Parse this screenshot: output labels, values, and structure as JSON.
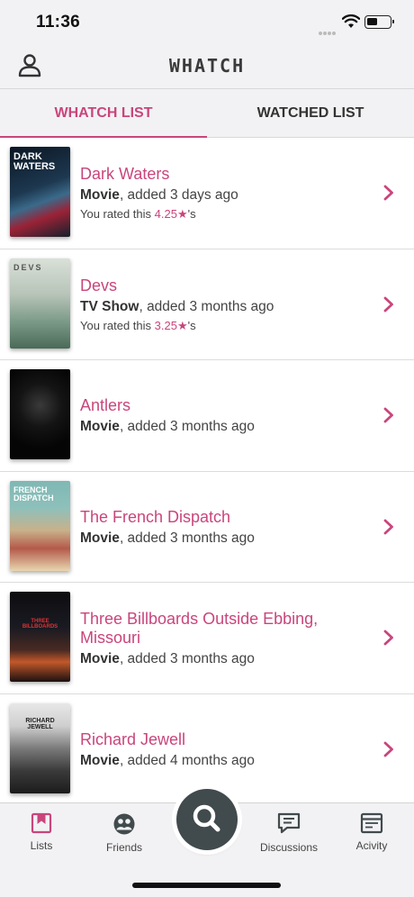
{
  "status_bar": {
    "time": "11:36"
  },
  "header": {
    "logo": "WHATCH",
    "profile_icon": "person-icon"
  },
  "tabs": [
    {
      "label": "WHATCH LIST",
      "active": true
    },
    {
      "label": "WATCHED LIST",
      "active": false
    }
  ],
  "accent_color": "#c9457c",
  "items": [
    {
      "title": "Dark Waters",
      "type": "Movie",
      "added": ", added 3 days ago",
      "rating_prefix": "You rated this ",
      "rating": "4.25★",
      "rating_suffix": "'s",
      "poster_text": "DARK WATERS"
    },
    {
      "title": "Devs",
      "type": "TV Show",
      "added": ", added 3 months ago",
      "rating_prefix": "You rated this ",
      "rating": "3.25★",
      "rating_suffix": "'s",
      "poster_text": "DEVS"
    },
    {
      "title": "Antlers",
      "type": "Movie",
      "added": ", added 3 months ago",
      "poster_text": ""
    },
    {
      "title": "The French Dispatch",
      "type": "Movie",
      "added": ", added 3 months ago",
      "poster_text": "FRENCH DISPATCH"
    },
    {
      "title": "Three Billboards Outside Ebbing, Missouri",
      "type": "Movie",
      "added": ", added 3 months ago",
      "poster_text": "THREE BILLBOARDS"
    },
    {
      "title": "Richard Jewell",
      "type": "Movie",
      "added": ", added 4 months ago",
      "poster_text": "RICHARD JEWELL"
    }
  ],
  "tab_bar": [
    {
      "label": "Lists",
      "icon": "bookmark-icon",
      "active": true
    },
    {
      "label": "Friends",
      "icon": "friends-icon",
      "active": false
    },
    {
      "label": "Discussions",
      "icon": "discussions-icon",
      "active": false
    },
    {
      "label": "Acivity",
      "icon": "activity-icon",
      "active": false
    }
  ],
  "search_fab": {
    "icon": "search-icon"
  }
}
